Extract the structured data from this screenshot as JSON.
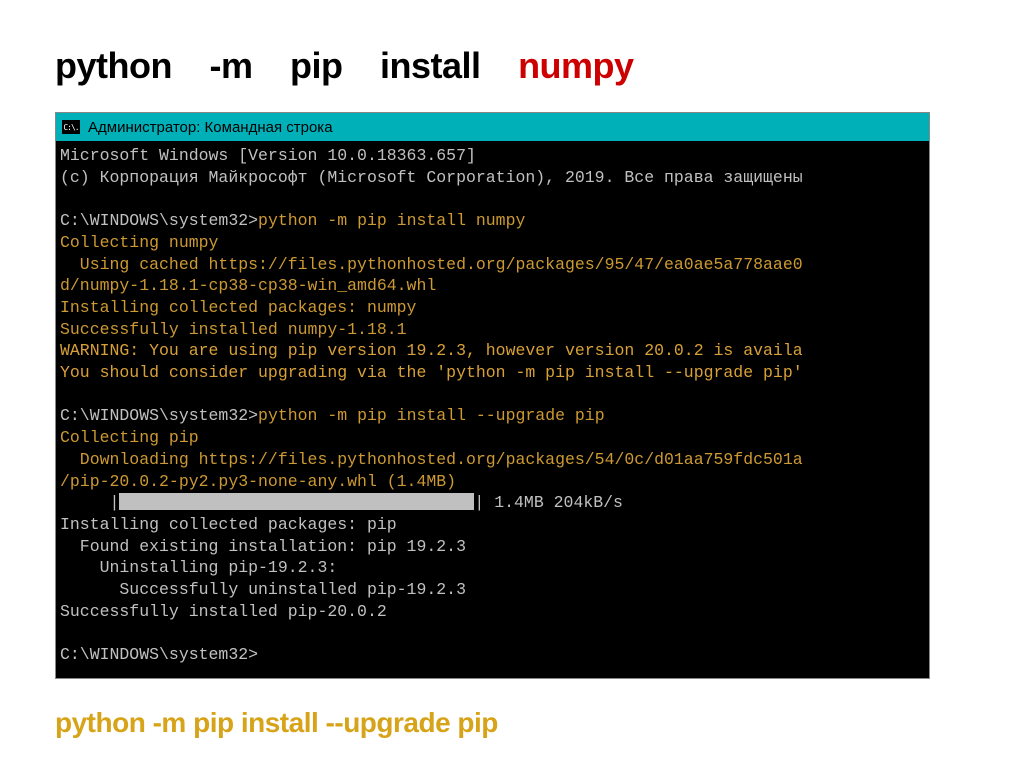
{
  "header_command": {
    "parts": [
      "python",
      "-m",
      "pip",
      "install"
    ],
    "package": "numpy"
  },
  "titlebar": {
    "icon_text": "C:\\.",
    "title": "Администратор: Командная строка"
  },
  "terminal": {
    "line01": "Microsoft Windows [Version 10.0.18363.657]",
    "line02": "(c) Корпорация Майкрософт (Microsoft Corporation), 2019. Все права защищены",
    "line03": "",
    "prompt1": "C:\\WINDOWS\\system32>",
    "cmd1": "python -m pip install numpy",
    "line05": "Collecting numpy",
    "line06": "  Using cached https://files.pythonhosted.org/packages/95/47/ea0ae5a778aae0",
    "line07": "d/numpy-1.18.1-cp38-cp38-win_amd64.whl",
    "line08": "Installing collected packages: numpy",
    "line09": "Successfully installed numpy-1.18.1",
    "warn1": "WARNING: You are using pip version 19.2.3, however version 20.0.2 is availa",
    "warn2": "You should consider upgrading via the 'python -m pip install --upgrade pip'",
    "line12": "",
    "prompt2": "C:\\WINDOWS\\system32>",
    "cmd2": "python -m pip install --upgrade pip",
    "line14": "Collecting pip",
    "line15": "  Downloading https://files.pythonhosted.org/packages/54/0c/d01aa759fdc501a",
    "line16": "/pip-20.0.2-py2.py3-none-any.whl (1.4MB)",
    "progress_indent": "     |",
    "progress_tail": "| 1.4MB 204kB/s",
    "line18": "Installing collected packages: pip",
    "line19": "  Found existing installation: pip 19.2.3",
    "line20": "    Uninstalling pip-19.2.3:",
    "line21": "      Successfully uninstalled pip-19.2.3",
    "line22": "Successfully installed pip-20.0.2",
    "line23": "",
    "prompt3": "C:\\WINDOWS\\system32>"
  },
  "footer_command": "python -m pip install --upgrade pip"
}
